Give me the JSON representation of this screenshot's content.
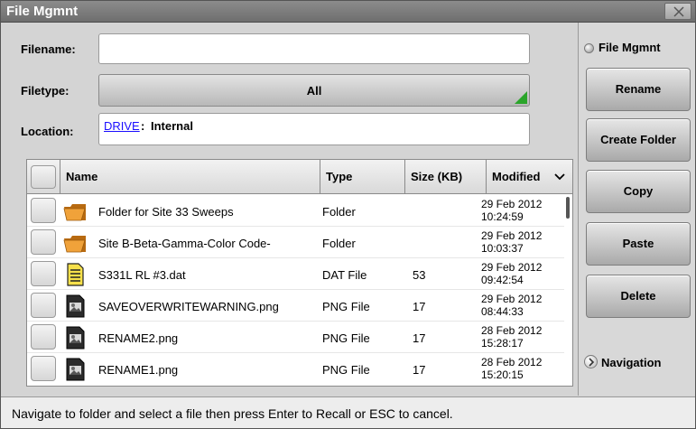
{
  "window": {
    "title": "File Mgmnt"
  },
  "form": {
    "filename_label": "Filename:",
    "filename_value": "",
    "filetype_label": "Filetype:",
    "filetype_value": "All",
    "location_label": "Location:",
    "location_drive": "DRIVE",
    "location_separator": ":",
    "location_value": "Internal"
  },
  "table": {
    "columns": [
      "Name",
      "Type",
      "Size (KB)",
      "Modified"
    ],
    "rows": [
      {
        "name": "Folder for Site 33 Sweeps",
        "type": "Folder",
        "size": "",
        "modified_date": "29 Feb 2012",
        "modified_time": "10:24:59",
        "icon": "folder-icon"
      },
      {
        "name": "Site B-Beta-Gamma-Color Code-",
        "type": "Folder",
        "size": "",
        "modified_date": "29 Feb 2012",
        "modified_time": "10:03:37",
        "icon": "folder-icon"
      },
      {
        "name": "S331L RL #3.dat",
        "type": "DAT File",
        "size": "53",
        "modified_date": "29 Feb 2012",
        "modified_time": "09:42:54",
        "icon": "dat-file-icon"
      },
      {
        "name": "SAVEOVERWRITEWARNING.png",
        "type": "PNG File",
        "size": "17",
        "modified_date": "29 Feb 2012",
        "modified_time": "08:44:33",
        "icon": "image-file-icon"
      },
      {
        "name": "RENAME2.png",
        "type": "PNG File",
        "size": "17",
        "modified_date": "28 Feb 2012",
        "modified_time": "15:28:17",
        "icon": "image-file-icon"
      },
      {
        "name": "RENAME1.png",
        "type": "PNG File",
        "size": "17",
        "modified_date": "28 Feb 2012",
        "modified_time": "15:20:15",
        "icon": "image-file-icon"
      }
    ]
  },
  "side_panel": {
    "title": "File Mgmnt",
    "buttons": [
      "Rename",
      "Create Folder",
      "Copy",
      "Paste",
      "Delete"
    ],
    "navigation_label": "Navigation"
  },
  "status": {
    "message": "Navigate to folder and select a file then press Enter to Recall or ESC to cancel."
  },
  "colors": {
    "link": "#1a0dff",
    "accent_green": "#2aa52a",
    "folder_orange": "#f0a23a"
  }
}
